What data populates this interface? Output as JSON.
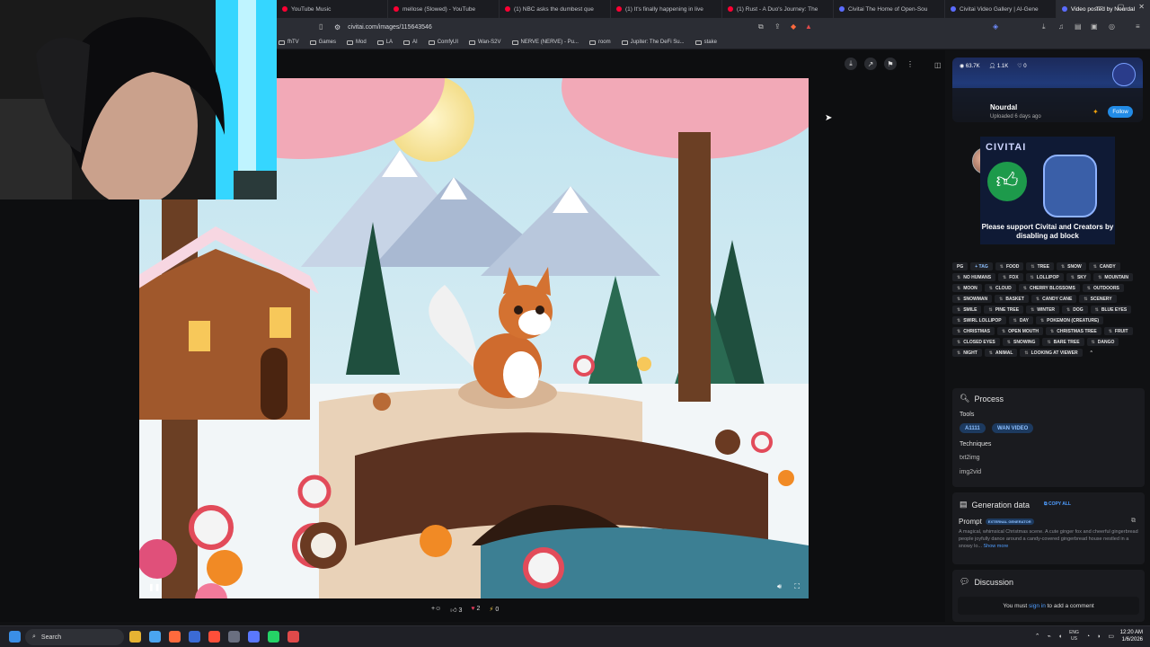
{
  "browser": {
    "tabs": [
      {
        "label": "YouTube Music",
        "color": "#ff0033"
      },
      {
        "label": "mellose (Slowed) - YouTube",
        "color": "#ff0033"
      },
      {
        "label": "(1) NBC asks the dumbest que",
        "color": "#ff0033"
      },
      {
        "label": "(1) It's finally happening in live",
        "color": "#ff0033"
      },
      {
        "label": "(1) Rust - A Duo's Journey: The",
        "color": "#ff0033"
      },
      {
        "label": "Civitai The Home of Open-Sou",
        "color": "#5b6cff"
      },
      {
        "label": "Civitai Video Gallery | AI-Gene",
        "color": "#5b6cff"
      },
      {
        "label": "Video posted by Nourdal",
        "color": "#5b6cff",
        "active": true
      }
    ],
    "url": "civitai.com/images/115643546",
    "bookmarks": [
      "fhTV",
      "Games",
      "Mod",
      "LA",
      "AI",
      "ComfyUI",
      "Wan-S2V",
      "NERVE (NERVE) - Pu...",
      "room",
      "Jupiter: The DeFi Su...",
      "stake"
    ]
  },
  "viewer": {
    "reactions": {
      "add": "+☺",
      "like": "3",
      "heart": "2",
      "bolt": "0"
    }
  },
  "sidebar": {
    "stats": {
      "views": "63.7K",
      "followers": "1.1K",
      "likes": "0"
    },
    "user": {
      "name": "Nourdal",
      "uploaded": "Uploaded 6 days ago",
      "follow_label": "Follow"
    },
    "ad": {
      "title": "CIVITAI",
      "text": "Please support Civitai and Creators by disabling ad block"
    },
    "tags": [
      "PG",
      "+ TAG",
      "FOOD",
      "TREE",
      "SNOW",
      "CANDY",
      "NO HUMANS",
      "FOX",
      "LOLLIPOP",
      "SKY",
      "MOUNTAIN",
      "MOON",
      "CLOUD",
      "CHERRY BLOSSOMS",
      "OUTDOORS",
      "SNOWMAN",
      "BASKET",
      "CANDY CANE",
      "SCENERY",
      "SMILE",
      "PINE TREE",
      "WINTER",
      "DOG",
      "BLUE EYES",
      "SWIRL LOLLIPOP",
      "DAY",
      "POKEMON (CREATURE)",
      "CHRISTMAS",
      "OPEN MOUTH",
      "CHRISTMAS TREE",
      "FRUIT",
      "CLOSED EYES",
      "SNOWING",
      "BARE TREE",
      "DANGO",
      "NIGHT",
      "ANIMAL",
      "LOOKING AT VIEWER"
    ],
    "process": {
      "title": "Process",
      "tools_label": "Tools",
      "tools": [
        "A1111",
        "WAN VIDEO"
      ],
      "techniques_label": "Techniques",
      "techniques": [
        "txt2img",
        "img2vid"
      ]
    },
    "generation": {
      "title": "Generation data",
      "copy_all": "COPY ALL",
      "prompt_label": "Prompt",
      "prompt_badge": "EXTERNAL GENERATOR",
      "prompt_text": "A magical, whimsical Christmas scene. A cute ginger fox and cheerful gingerbread people joyfully dance around a candy-covered gingerbread house nestled in a snowy lo...",
      "show_more": "Show more"
    },
    "discussion": {
      "title": "Discussion",
      "text_pre": "You must ",
      "link": "sign in",
      "text_post": " to add a comment"
    }
  },
  "taskbar": {
    "search": "Search",
    "lang": "ENG",
    "region": "US",
    "time": "12:20 AM",
    "date": "1/6/2026"
  }
}
